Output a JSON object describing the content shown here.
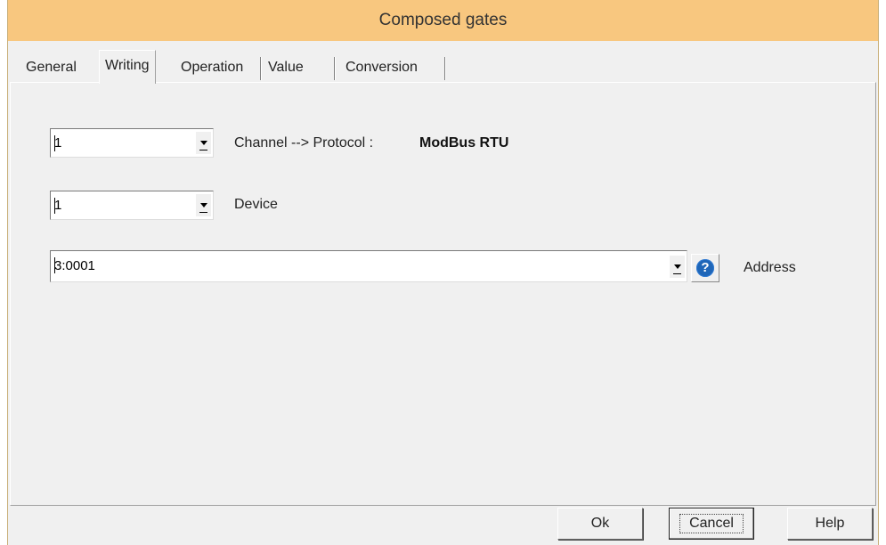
{
  "window": {
    "title": "Composed gates"
  },
  "tabs": [
    {
      "label": "General"
    },
    {
      "label": "Writing"
    },
    {
      "label": "Operation"
    },
    {
      "label": "Value"
    },
    {
      "label": "Conversion"
    }
  ],
  "writing": {
    "channel": {
      "value": "1",
      "label": "Channel --> Protocol :",
      "protocol": "ModBus RTU"
    },
    "device": {
      "value": "1",
      "label": "Device"
    },
    "address": {
      "value": "3:0001",
      "label": "Address"
    }
  },
  "buttons": {
    "ok": "Ok",
    "cancel": "Cancel",
    "help": "Help"
  },
  "icons": {
    "help": "question-circle-icon",
    "dropdown": "chevron-down-icon"
  },
  "colors": {
    "titlebar": "#f8c77f",
    "help_icon": "#1f66b8"
  }
}
